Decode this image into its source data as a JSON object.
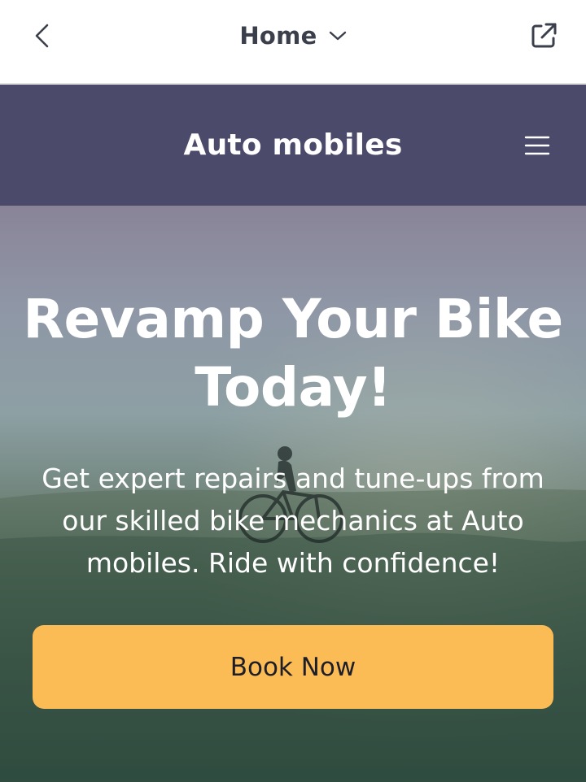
{
  "nav": {
    "title": "Home",
    "back_icon": "chevron-left-icon",
    "dropdown_icon": "chevron-down-icon",
    "external_icon": "external-link-icon"
  },
  "header": {
    "brand": "Auto mobiles",
    "menu_icon": "hamburger-menu-icon",
    "background": "#4b4a6b"
  },
  "hero": {
    "headline": "Revamp Your Bike Today!",
    "subtext": "Get expert repairs and tune-ups from our skilled bike mechanics at Auto mobiles. Ride with confidence!",
    "cta_label": "Book Now",
    "cta_color": "#fcbc55"
  }
}
